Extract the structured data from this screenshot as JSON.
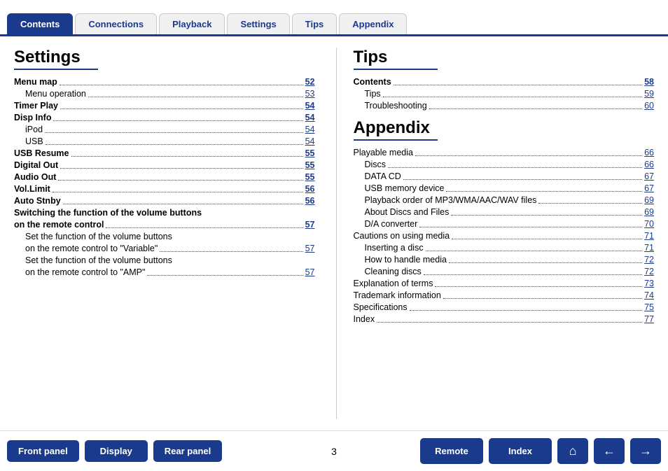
{
  "tabs": [
    {
      "label": "Contents",
      "active": true
    },
    {
      "label": "Connections",
      "active": false
    },
    {
      "label": "Playback",
      "active": false
    },
    {
      "label": "Settings",
      "active": false
    },
    {
      "label": "Tips",
      "active": false
    },
    {
      "label": "Appendix",
      "active": false
    }
  ],
  "settings": {
    "title": "Settings",
    "items": [
      {
        "label": "Menu map",
        "page": "52",
        "bold": true,
        "indent": 0
      },
      {
        "label": "Menu operation",
        "page": "53",
        "bold": false,
        "indent": 1
      },
      {
        "label": "Timer Play",
        "page": "54",
        "bold": true,
        "indent": 0
      },
      {
        "label": "Disp Info",
        "page": "54",
        "bold": true,
        "indent": 0
      },
      {
        "label": "iPod",
        "page": "54",
        "bold": false,
        "indent": 1
      },
      {
        "label": "USB",
        "page": "54",
        "bold": false,
        "indent": 1
      },
      {
        "label": "USB Resume",
        "page": "55",
        "bold": true,
        "indent": 0
      },
      {
        "label": "Digital Out",
        "page": "55",
        "bold": true,
        "indent": 0
      },
      {
        "label": "Audio Out",
        "page": "55",
        "bold": true,
        "indent": 0
      },
      {
        "label": "Vol.Limit",
        "page": "56",
        "bold": true,
        "indent": 0
      },
      {
        "label": "Auto Stnby",
        "page": "56",
        "bold": true,
        "indent": 0
      },
      {
        "label": "Switching the function of the volume buttons",
        "page": "",
        "bold": true,
        "indent": 0,
        "nopage": true
      },
      {
        "label": "on the remote control",
        "page": "57",
        "bold": true,
        "indent": 0
      },
      {
        "label": "Set the function of the volume buttons",
        "page": "",
        "bold": false,
        "indent": 1,
        "nopage": true
      },
      {
        "label": "on the remote control to \"Variable\"",
        "page": "57",
        "bold": false,
        "indent": 1
      },
      {
        "label": "Set the function of the volume buttons",
        "page": "",
        "bold": false,
        "indent": 1,
        "nopage": true
      },
      {
        "label": "on the remote control to \"AMP\"",
        "page": "57",
        "bold": false,
        "indent": 1
      }
    ]
  },
  "tips": {
    "title": "Tips",
    "items": [
      {
        "label": "Contents",
        "page": "58",
        "bold": true,
        "indent": 0
      },
      {
        "label": "Tips",
        "page": "59",
        "bold": false,
        "indent": 1
      },
      {
        "label": "Troubleshooting",
        "page": "60",
        "bold": false,
        "indent": 1
      }
    ]
  },
  "appendix": {
    "title": "Appendix",
    "items": [
      {
        "label": "Playable media",
        "page": "66",
        "bold": false,
        "indent": 0
      },
      {
        "label": "Discs",
        "page": "66",
        "bold": false,
        "indent": 1
      },
      {
        "label": "DATA CD",
        "page": "67",
        "bold": false,
        "indent": 1
      },
      {
        "label": "USB memory device",
        "page": "67",
        "bold": false,
        "indent": 1
      },
      {
        "label": "Playback order of MP3/WMA/AAC/WAV files",
        "page": "69",
        "bold": false,
        "indent": 1
      },
      {
        "label": "About Discs and Files",
        "page": "69",
        "bold": false,
        "indent": 1
      },
      {
        "label": "D/A converter",
        "page": "70",
        "bold": false,
        "indent": 1
      },
      {
        "label": "Cautions on using media",
        "page": "71",
        "bold": false,
        "indent": 0
      },
      {
        "label": "Inserting a disc",
        "page": "71",
        "bold": false,
        "indent": 1
      },
      {
        "label": "How to handle media",
        "page": "72",
        "bold": false,
        "indent": 1
      },
      {
        "label": "Cleaning discs",
        "page": "72",
        "bold": false,
        "indent": 1
      },
      {
        "label": "Explanation of terms",
        "page": "73",
        "bold": false,
        "indent": 0
      },
      {
        "label": "Trademark information",
        "page": "74",
        "bold": false,
        "indent": 0
      },
      {
        "label": "Specifications",
        "page": "75",
        "bold": false,
        "indent": 0
      },
      {
        "label": "Index",
        "page": "77",
        "bold": false,
        "indent": 0
      }
    ]
  },
  "bottom": {
    "page_number": "3",
    "buttons_left": [
      {
        "label": "Front panel",
        "name": "front-panel-button"
      },
      {
        "label": "Display",
        "name": "display-button"
      },
      {
        "label": "Rear panel",
        "name": "rear-panel-button"
      }
    ],
    "buttons_right": [
      {
        "label": "Remote",
        "name": "remote-button"
      },
      {
        "label": "Index",
        "name": "index-button"
      },
      {
        "label": "home",
        "name": "home-button",
        "icon": "⌂"
      },
      {
        "label": "back",
        "name": "back-button",
        "icon": "←"
      },
      {
        "label": "forward",
        "name": "forward-button",
        "icon": "→"
      }
    ]
  }
}
